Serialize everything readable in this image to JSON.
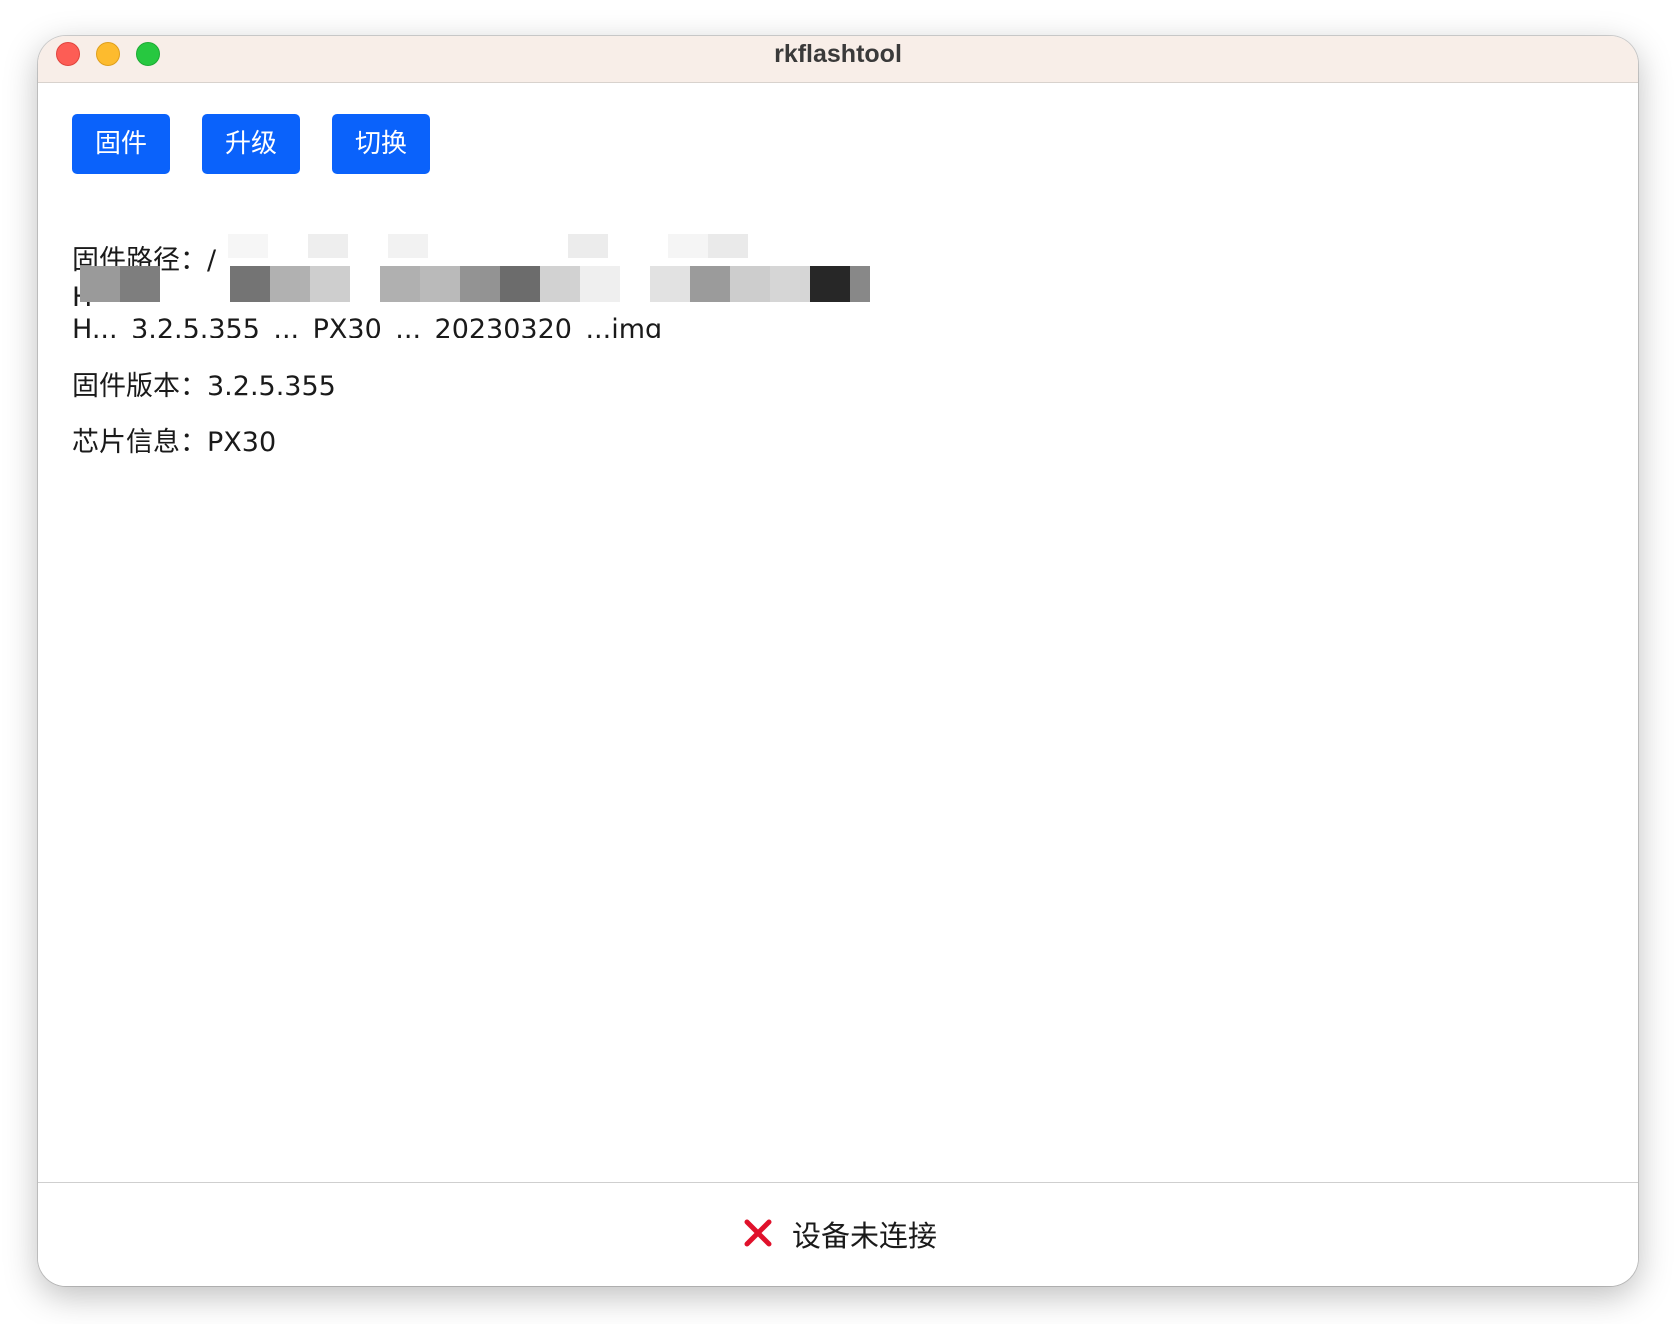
{
  "window": {
    "title": "rkflashtool"
  },
  "toolbar": {
    "firmware_label": "固件",
    "upgrade_label": "升级",
    "switch_label": "切换"
  },
  "firmware_info": {
    "path_label": "固件路径：/",
    "path_line2": "H",
    "path_line3": "H..._3.2.5.355_..._PX30_..._20230320_...img",
    "version_label": "固件版本：",
    "version_value": "3.2.5.355",
    "chip_label": "芯片信息：",
    "chip_value": "PX30"
  },
  "status": {
    "icon": "close-icon",
    "text": "设备未连接",
    "icon_color": "#e0112b"
  },
  "colors": {
    "button_bg": "#0a62fb",
    "titlebar_bg": "#f8eee8"
  }
}
